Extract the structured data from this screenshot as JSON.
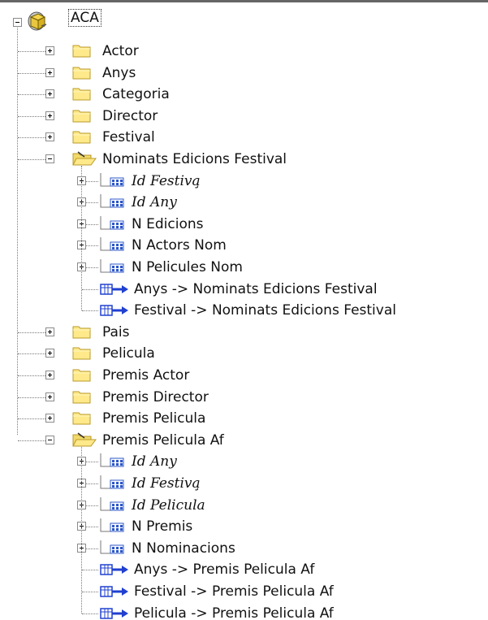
{
  "tree": {
    "root": {
      "label": "ACA",
      "icon": "database-cube-icon",
      "expanded": true
    },
    "items": [
      {
        "label": "Actor",
        "level": 1,
        "type": "folder",
        "expanded": false
      },
      {
        "label": "Anys",
        "level": 1,
        "type": "folder",
        "expanded": false
      },
      {
        "label": "Categoria",
        "level": 1,
        "type": "folder",
        "expanded": false
      },
      {
        "label": "Director",
        "level": 1,
        "type": "folder",
        "expanded": false
      },
      {
        "label": "Festival",
        "level": 1,
        "type": "folder",
        "expanded": false
      },
      {
        "label": "Nominats Edicions Festival",
        "level": 1,
        "type": "folder",
        "expanded": true
      },
      {
        "label": "Id Festiva̧",
        "level": 2,
        "type": "table-column",
        "italic": true
      },
      {
        "label": "Id Any",
        "level": 2,
        "type": "table-column",
        "italic": true
      },
      {
        "label": "N Edicions",
        "level": 2,
        "type": "table-column",
        "italic": false
      },
      {
        "label": "N Actors Nom",
        "level": 2,
        "type": "table-column",
        "italic": false
      },
      {
        "label": "N Pelicules Nom",
        "level": 2,
        "type": "table-column",
        "italic": false
      },
      {
        "label": "Anys -> Nominats Edicions Festival",
        "level": 2,
        "type": "relationship"
      },
      {
        "label": "Festival -> Nominats Edicions Festival",
        "level": 2,
        "type": "relationship"
      },
      {
        "label": "Pais",
        "level": 1,
        "type": "folder",
        "expanded": false
      },
      {
        "label": "Pelicula",
        "level": 1,
        "type": "folder",
        "expanded": false
      },
      {
        "label": "Premis Actor",
        "level": 1,
        "type": "folder",
        "expanded": false
      },
      {
        "label": "Premis Director",
        "level": 1,
        "type": "folder",
        "expanded": false
      },
      {
        "label": "Premis Pelicula",
        "level": 1,
        "type": "folder",
        "expanded": false
      },
      {
        "label": "Premis Pelicula Af",
        "level": 1,
        "type": "folder",
        "expanded": true
      },
      {
        "label": "Id Any",
        "level": 2,
        "type": "table-column",
        "italic": true
      },
      {
        "label": "Id Festiva̧",
        "level": 2,
        "type": "table-column",
        "italic": true
      },
      {
        "label": "Id Pelicula",
        "level": 2,
        "type": "table-column",
        "italic": true
      },
      {
        "label": "N Premis",
        "level": 2,
        "type": "table-column",
        "italic": false
      },
      {
        "label": "N Nominacions",
        "level": 2,
        "type": "table-column",
        "italic": false
      },
      {
        "label": "Anys -> Premis Pelicula Af",
        "level": 2,
        "type": "relationship"
      },
      {
        "label": "Festival -> Premis Pelicula Af",
        "level": 2,
        "type": "relationship"
      },
      {
        "label": "Pelicula -> Premis Pelicula Af",
        "level": 2,
        "type": "relationship"
      }
    ]
  },
  "colors": {
    "folder_fill": "#ffe98a",
    "folder_stroke": "#b89a2a",
    "column_blue": "#2b56c9",
    "relationship_blue": "#2040d0",
    "tree_line": "#7a7a7a"
  }
}
